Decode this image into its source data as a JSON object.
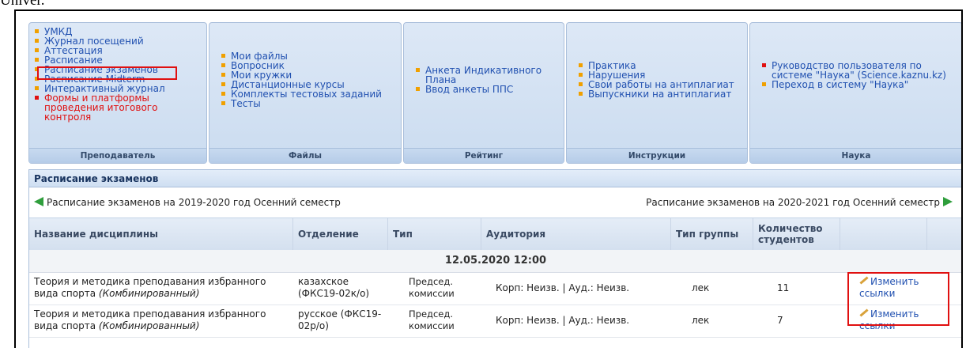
{
  "page": {
    "top_fragment": "Univer."
  },
  "panels": {
    "teacher": {
      "footer": "Преподаватель",
      "items": [
        {
          "label": "УМКД",
          "red": false
        },
        {
          "label": "Журнал посещений",
          "red": false
        },
        {
          "label": "Аттестация",
          "red": false
        },
        {
          "label": "Расписание",
          "red": false
        },
        {
          "label": "Расписание экзаменов",
          "red": false
        },
        {
          "label": "Расписание Midterm",
          "red": false
        },
        {
          "label": "Интерактивный журнал",
          "red": false
        },
        {
          "label": "Формы и платформы проведения итогового контроля",
          "red": true
        }
      ]
    },
    "files": {
      "footer": "Файлы",
      "items": [
        {
          "label": "Мои файлы"
        },
        {
          "label": "Вопросник"
        },
        {
          "label": "Мои кружки"
        },
        {
          "label": "Дистанционные курсы"
        },
        {
          "label": "Комплекты тестовых заданий"
        },
        {
          "label": "Тесты"
        }
      ]
    },
    "rating": {
      "footer": "Рейтинг",
      "items": [
        {
          "label": "Анкета Индикативного Плана"
        },
        {
          "label": "Ввод анкеты ППС"
        }
      ]
    },
    "instructions": {
      "footer": "Инструкции",
      "items": [
        {
          "label": "Практика"
        },
        {
          "label": "Нарушения"
        },
        {
          "label": "Свои работы на антиплагиат"
        },
        {
          "label": "Выпускники на антиплагиат"
        }
      ]
    },
    "science": {
      "footer": "Наука",
      "items": [
        {
          "label": "Руководство пользователя по системе \"Наука\" (Science.kaznu.kz)",
          "red_bullet": true
        },
        {
          "label": "Переход в систему \"Наука\""
        }
      ]
    }
  },
  "schedule": {
    "title": "Расписание экзаменов",
    "prev_link": "Расписание экзаменов на 2019-2020 год Осенний семестр",
    "next_link": "Расписание экзаменов на 2020-2021 год Осенний семестр",
    "columns": {
      "discipline": "Название дисциплины",
      "department": "Отделение",
      "type": "Тип",
      "room": "Аудитория",
      "group_type": "Тип группы",
      "students": "Количество студентов"
    },
    "date_group": "12.05.2020 12:00",
    "rows": [
      {
        "discipline": "Теория и методика преподавания избранного вида спорта",
        "discipline_mode": "(Комбинированный)",
        "department": "казахское (ФКС19-02к/о)",
        "type": "Председ. комиссии",
        "room": "Корп: Неизв. | Ауд.: Неизв.",
        "group_type": "лек",
        "students": "11",
        "action": "Изменить ссылки"
      },
      {
        "discipline": "Теория и методика преподавания избранного вида спорта",
        "discipline_mode": "(Комбинированный)",
        "department": "русское (ФКС19-02р/о)",
        "type": "Председ. комиссии",
        "room": "Корп: Неизв. | Ауд.: Неизв.",
        "group_type": "лек",
        "students": "7",
        "action": "Изменить ссылки"
      }
    ]
  },
  "colors": {
    "link": "#2050b0",
    "bullet": "#f0a000",
    "highlight": "#e01010",
    "arrow": "#2f9e3c"
  }
}
